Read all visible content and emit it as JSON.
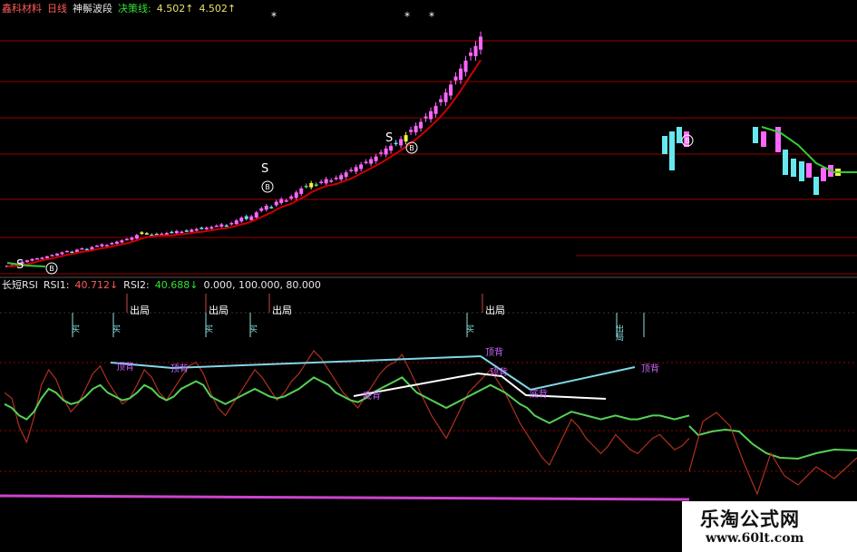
{
  "top_header": {
    "stock_name": "鑫科材料",
    "period": "日线",
    "indicator": "神鬃波段",
    "decision_label": "决策线:",
    "decision_value": "4.502↑",
    "decision_value2": "4.502↑"
  },
  "rsi_header": {
    "name": "长短RSI",
    "rsi1_label": "RSI1:",
    "rsi1_value": "40.712↓",
    "rsi2_label": "RSI2:",
    "rsi2_value": "40.688↓",
    "levels_text": "0.000, 100.000, 80.000"
  },
  "watermark": {
    "title": "乐淘公式网",
    "url": "www.60lt.com"
  },
  "colors": {
    "up_candle": "#ff66ff",
    "down_candle": "#66e8ee",
    "buy_candle": "#6cd26c",
    "buy_candle2": "#f2f24a",
    "ma_line": "#cc0000",
    "ma_green": "#33cc33",
    "grid_red": "#990000",
    "rsi1": "#b03020",
    "rsi2": "#55d055",
    "trend_cyan": "#7fd7e6",
    "trend_white": "#ffffff",
    "level_magenta": "#cc44cc",
    "label_magenta": "#cc66ff",
    "marker_cyan": "#8fe0e0"
  },
  "chart_data": [
    {
      "type": "candlestick",
      "note_labels": {
        "sell": "S",
        "buy": "B",
        "star": "*"
      },
      "x": [
        1,
        2,
        3,
        4,
        5,
        6,
        7,
        8,
        9,
        10,
        11,
        12,
        13,
        14,
        15,
        16,
        17,
        18,
        19,
        20,
        21,
        22,
        23,
        24,
        25,
        26,
        27,
        28,
        29,
        30,
        31,
        32,
        33,
        34,
        35,
        36,
        37,
        38,
        39,
        40,
        41,
        42,
        43,
        44,
        45,
        46,
        47,
        48,
        49,
        50,
        51,
        52,
        53,
        54,
        55,
        56,
        57,
        58,
        59,
        60,
        61,
        62,
        63,
        64,
        65,
        66,
        67,
        68,
        69,
        70,
        71,
        72,
        73,
        74,
        75,
        76,
        77,
        78,
        79,
        80,
        81,
        82,
        83,
        84,
        85,
        86,
        87,
        88,
        89,
        90,
        91,
        92,
        93,
        94,
        95,
        96,
        97,
        98,
        99,
        100,
        101,
        102,
        103,
        104,
        105,
        106,
        107,
        108,
        109,
        110,
        111,
        112,
        113,
        114
      ],
      "close": [
        2.0,
        2.05,
        2.1,
        2.3,
        2.4,
        2.5,
        2.55,
        2.6,
        2.7,
        2.8,
        2.9,
        3.0,
        3.1,
        3.05,
        3.2,
        3.3,
        3.25,
        3.4,
        3.5,
        3.6,
        3.55,
        3.7,
        3.8,
        3.9,
        4.0,
        4.1,
        4.3,
        4.5,
        4.4,
        4.3,
        4.35,
        4.4,
        4.45,
        4.5,
        4.6,
        4.55,
        4.6,
        4.7,
        4.75,
        4.8,
        4.85,
        4.9,
        5.0,
        5.1,
        5.0,
        5.2,
        5.4,
        5.6,
        5.5,
        5.7,
        6.0,
        6.3,
        6.5,
        6.4,
        6.8,
        7.0,
        6.9,
        7.2,
        7.5,
        7.8,
        8.0,
        8.2,
        8.1,
        8.3,
        8.5,
        8.4,
        8.6,
        8.8,
        9.0,
        9.2,
        9.4,
        9.6,
        9.8,
        10.0,
        10.2,
        10.5,
        10.8,
        11.0,
        11.2,
        11.5,
        11.8,
        12.2,
        12.5,
        12.8,
        13.2,
        13.6,
        14.0,
        14.5,
        15.0,
        15.6,
        16.2,
        16.8,
        17.4,
        18.0,
        18.5,
        19.2
      ],
      "ma_line_color": "red",
      "right_section": {
        "x_range": [
          120,
          190
        ],
        "colors": [
          "cyan",
          "green",
          "yellow"
        ]
      }
    },
    {
      "type": "line",
      "title": "长短RSI",
      "series": [
        {
          "name": "RSI1",
          "values": [
            58,
            55,
            40,
            32,
            45,
            62,
            70,
            65,
            55,
            48,
            52,
            60,
            68,
            72,
            64,
            58,
            52,
            55,
            62,
            70,
            66,
            58,
            54,
            60,
            66,
            72,
            74,
            68,
            58,
            50,
            46,
            52,
            58,
            64,
            70,
            66,
            60,
            54,
            58,
            64,
            68,
            74,
            80,
            76,
            70,
            64,
            58,
            54,
            50,
            56,
            62,
            68,
            72,
            74,
            78,
            70,
            62,
            54,
            46,
            40,
            34,
            42,
            50,
            58,
            62,
            66,
            70,
            64,
            58,
            50,
            42,
            36,
            30,
            24,
            20,
            28,
            36,
            44,
            40,
            34,
            30,
            26,
            30,
            36,
            32,
            28,
            26,
            30,
            34,
            36,
            32,
            28,
            30,
            34
          ]
        },
        {
          "name": "RSI2",
          "values": [
            52,
            50,
            46,
            44,
            48,
            55,
            60,
            58,
            54,
            52,
            53,
            56,
            60,
            62,
            58,
            56,
            54,
            55,
            58,
            62,
            60,
            56,
            54,
            56,
            60,
            62,
            64,
            62,
            56,
            54,
            52,
            54,
            56,
            58,
            60,
            58,
            56,
            55,
            56,
            58,
            60,
            63,
            66,
            64,
            62,
            58,
            56,
            54,
            53,
            55,
            58,
            60,
            62,
            64,
            66,
            62,
            58,
            56,
            54,
            52,
            50,
            52,
            54,
            56,
            58,
            60,
            62,
            60,
            58,
            55,
            52,
            50,
            46,
            44,
            42,
            44,
            46,
            48,
            47,
            46,
            45,
            44,
            45,
            46,
            45,
            44,
            44,
            45,
            46,
            46,
            45,
            44,
            45,
            46
          ]
        }
      ],
      "levels": [
        0,
        100,
        80
      ],
      "signals": [
        {
          "text": "买",
          "color": "cyan"
        },
        {
          "text": "出局",
          "color": "white"
        },
        {
          "text": "买",
          "color": "cyan"
        },
        {
          "text": "出局",
          "color": "white"
        },
        {
          "text": "买",
          "color": "cyan"
        },
        {
          "text": "出局",
          "color": "white"
        },
        {
          "text": "买",
          "color": "cyan"
        },
        {
          "text": "出局",
          "color": "white"
        },
        {
          "text": "买",
          "color": "cyan"
        },
        {
          "text": "出局",
          "color": "white"
        }
      ],
      "annotations": [
        "顶背",
        "顶背",
        "顶背",
        "底背",
        "顶背",
        "底背",
        "顶背"
      ]
    }
  ]
}
